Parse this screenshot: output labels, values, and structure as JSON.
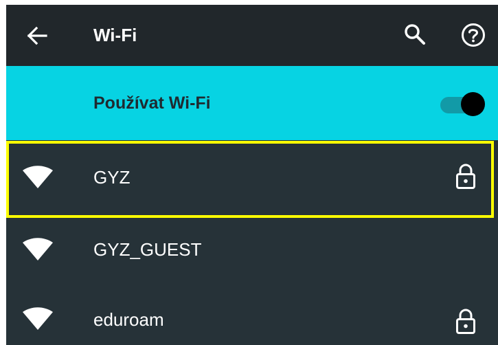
{
  "toolbar": {
    "title": "Wi-Fi",
    "back_icon": "arrow-left-icon",
    "search_icon": "search-icon",
    "help_icon": "help-circle-icon"
  },
  "master_switch": {
    "label": "Používat Wi-Fi",
    "state": "on"
  },
  "networks": [
    {
      "ssid": "GYZ",
      "secured": true,
      "highlighted": true
    },
    {
      "ssid": "GYZ_GUEST",
      "secured": false,
      "highlighted": false
    },
    {
      "ssid": "eduroam",
      "secured": true,
      "highlighted": false
    }
  ],
  "colors": {
    "toolbar_bg": "#21272b",
    "list_bg": "#263238",
    "accent": "#07d3e3",
    "toggle_track": "#129aa7",
    "highlight": "#ffff00",
    "icon": "#ffffff"
  }
}
